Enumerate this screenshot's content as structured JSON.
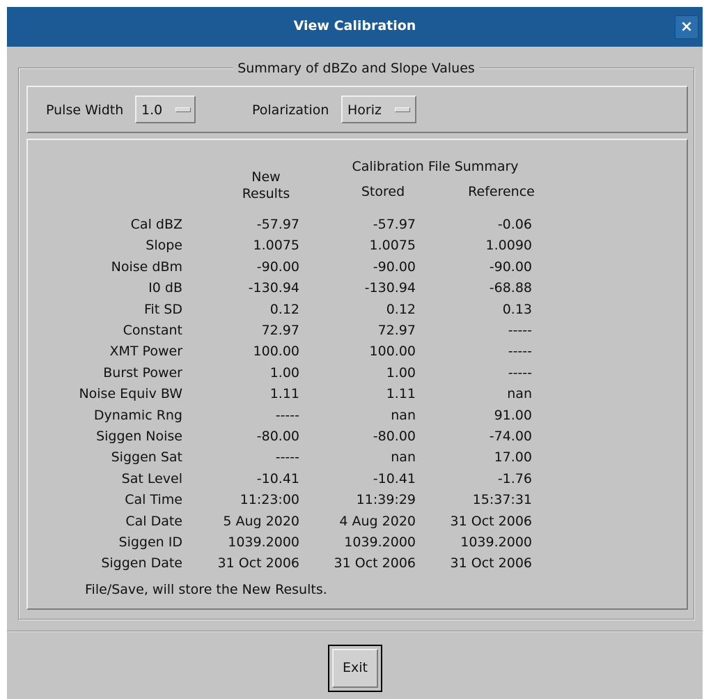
{
  "window": {
    "title": "View Calibration",
    "close_glyph": "×"
  },
  "group_title": "Summary of dBZo and Slope Values",
  "controls": {
    "pulse_width_label": "Pulse Width",
    "pulse_width_value": "1.0",
    "polarization_label": "Polarization",
    "polarization_value": "Horiz"
  },
  "table": {
    "super_header": "Calibration File Summary",
    "columns": [
      "New\nResults",
      "Stored",
      "Reference"
    ],
    "rows": [
      {
        "label": "Cal dBZ",
        "new": "-57.97",
        "stored": "-57.97",
        "reference": "-0.06"
      },
      {
        "label": "Slope",
        "new": "1.0075",
        "stored": "1.0075",
        "reference": "1.0090"
      },
      {
        "label": "Noise dBm",
        "new": "-90.00",
        "stored": "-90.00",
        "reference": "-90.00"
      },
      {
        "label": "I0 dB",
        "new": "-130.94",
        "stored": "-130.94",
        "reference": "-68.88"
      },
      {
        "label": "Fit SD",
        "new": "0.12",
        "stored": "0.12",
        "reference": "0.13"
      },
      {
        "label": "Constant",
        "new": "72.97",
        "stored": "72.97",
        "reference": "-----"
      },
      {
        "label": "XMT Power",
        "new": "100.00",
        "stored": "100.00",
        "reference": "-----"
      },
      {
        "label": "Burst Power",
        "new": "1.00",
        "stored": "1.00",
        "reference": "-----"
      },
      {
        "label": "Noise Equiv BW",
        "new": "1.11",
        "stored": "1.11",
        "reference": "nan"
      },
      {
        "label": "Dynamic Rng",
        "new": "-----",
        "stored": "nan",
        "reference": "91.00"
      },
      {
        "label": "Siggen Noise",
        "new": "-80.00",
        "stored": "-80.00",
        "reference": "-74.00"
      },
      {
        "label": "Siggen Sat",
        "new": "-----",
        "stored": "nan",
        "reference": "17.00"
      },
      {
        "label": "Sat Level",
        "new": "-10.41",
        "stored": "-10.41",
        "reference": "-1.76"
      },
      {
        "label": "Cal Time",
        "new": "11:23:00",
        "stored": "11:39:29",
        "reference": "15:37:31"
      },
      {
        "label": "Cal Date",
        "new": "5 Aug 2020",
        "stored": "4 Aug 2020",
        "reference": "31 Oct 2006"
      },
      {
        "label": "Siggen ID",
        "new": "1039.2000",
        "stored": "1039.2000",
        "reference": "1039.2000"
      },
      {
        "label": "Siggen Date",
        "new": "31 Oct 2006",
        "stored": "31 Oct 2006",
        "reference": "31 Oct 2006"
      }
    ]
  },
  "note": "File/Save, will store the New Results.",
  "exit_label": "Exit",
  "colors": {
    "titlebar": "#1c5a96",
    "background": "#c4c4c4"
  }
}
